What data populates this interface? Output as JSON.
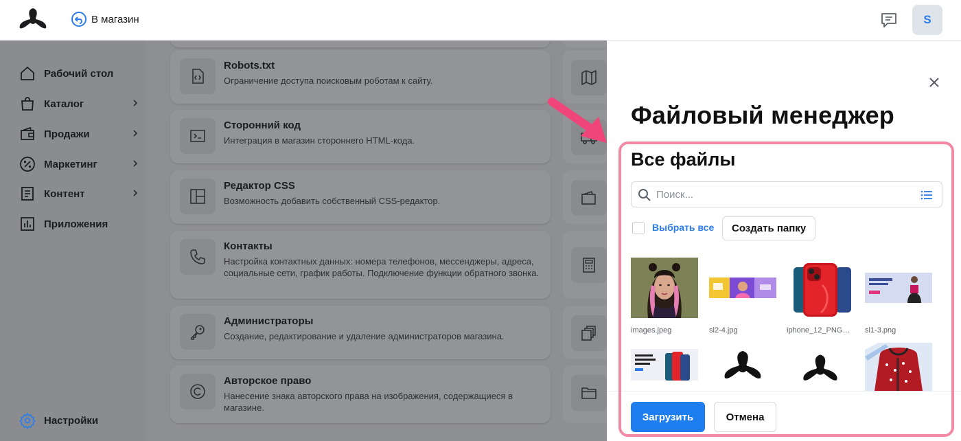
{
  "topbar": {
    "back_label": "В магазин",
    "avatar_initial": "S"
  },
  "sidebar": {
    "items": [
      {
        "label": "Рабочий стол",
        "icon": "home-icon",
        "has_submenu": false
      },
      {
        "label": "Каталог",
        "icon": "bag-icon",
        "has_submenu": true
      },
      {
        "label": "Продажи",
        "icon": "wallet-icon",
        "has_submenu": true
      },
      {
        "label": "Маркетинг",
        "icon": "percent-icon",
        "has_submenu": true
      },
      {
        "label": "Контент",
        "icon": "document-icon",
        "has_submenu": true
      },
      {
        "label": "Приложения",
        "icon": "chart-icon",
        "has_submenu": false
      }
    ],
    "settings_label": "Настройки"
  },
  "settings_cards": [
    {
      "title": "Robots.txt",
      "desc": "Ограничение доступа поисковым роботам к сайту.",
      "icon": "code-file-icon"
    },
    {
      "title": "Сторонний код",
      "desc": "Интеграция в магазин стороннего HTML-кода.",
      "icon": "terminal-icon"
    },
    {
      "title": "Редактор CSS",
      "desc": "Возможность добавить собственный CSS-редактор.",
      "icon": "layout-icon"
    },
    {
      "title": "Контакты",
      "desc": "Настройка контактных данных: номера телефонов, мессенджеры, адреса, социальные сети, график работы. Подключение функции обратного звонка.",
      "icon": "phone-icon"
    },
    {
      "title": "Администраторы",
      "desc": "Создание, редактирование и удаление администраторов магазина.",
      "icon": "key-icon"
    },
    {
      "title": "Авторское право",
      "desc": "Нанесение знака авторского права на изображения, содержащиеся в магазине.",
      "icon": "copyright-icon"
    }
  ],
  "file_manager": {
    "title": "Файловый менеджер",
    "section_title": "Все файлы",
    "search_placeholder": "Поиск...",
    "select_all_label": "Выбрать все",
    "new_folder_label": "Создать папку",
    "files": [
      {
        "name": "images.jpeg",
        "kind": "portrait-photo"
      },
      {
        "name": "sl2-4.jpg",
        "kind": "banner"
      },
      {
        "name": "iphone_12_PNG23....",
        "kind": "phone"
      },
      {
        "name": "sl1-3.png",
        "kind": "banner-woman"
      },
      {
        "name": "",
        "kind": "phone-banner"
      },
      {
        "name": "",
        "kind": "logo"
      },
      {
        "name": "",
        "kind": "logo"
      },
      {
        "name": "",
        "kind": "hoodie"
      }
    ],
    "upload_label": "Загрузить",
    "cancel_label": "Отмена"
  },
  "colors": {
    "accent": "#1e7ef0",
    "highlight": "#f28aa5",
    "arrow": "#f0457a"
  }
}
